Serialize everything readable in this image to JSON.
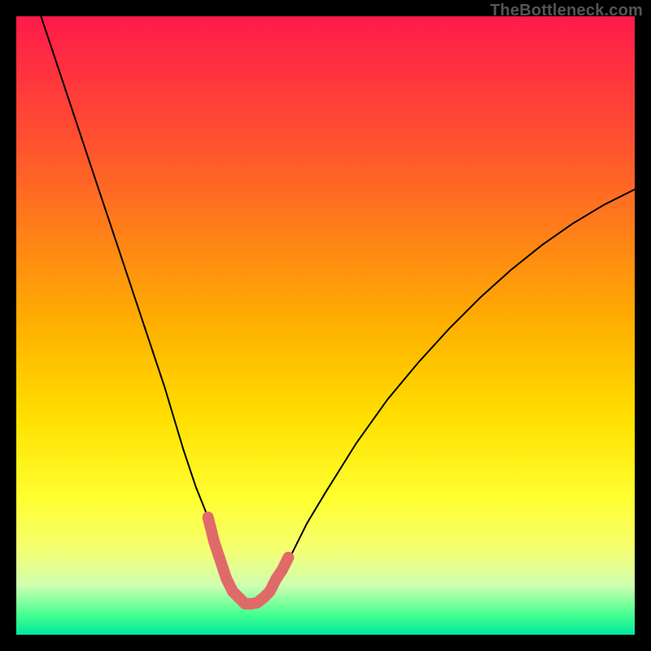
{
  "watermark": "TheBottleneck.com",
  "chart_data": {
    "type": "line",
    "title": "",
    "xlabel": "",
    "ylabel": "",
    "xlim": [
      0,
      100
    ],
    "ylim": [
      0,
      100
    ],
    "series": [
      {
        "name": "black-curve",
        "x": [
          4,
          8,
          12,
          16,
          20,
          24,
          27,
          29,
          31,
          33,
          34.5,
          36,
          37.5,
          39,
          41,
          44,
          47,
          50,
          55,
          60,
          65,
          70,
          75,
          80,
          85,
          90,
          95,
          100
        ],
        "y": [
          100,
          88,
          76,
          64,
          52,
          40,
          30,
          24,
          19,
          13,
          9,
          6,
          5,
          5,
          7,
          12,
          18,
          23,
          31,
          38,
          44,
          49.5,
          54.5,
          59,
          63,
          66.5,
          69.5,
          72
        ]
      },
      {
        "name": "pink-u-segment",
        "x": [
          31,
          32,
          33,
          34,
          35,
          36,
          37,
          38,
          39,
          40,
          41,
          42,
          43,
          44
        ],
        "y": [
          19,
          15,
          12,
          9,
          7,
          6,
          5,
          5,
          5.2,
          6,
          7,
          9,
          10.5,
          12.5
        ]
      }
    ],
    "colors": {
      "black_curve": "#000000",
      "pink_segment": "#e06a6a"
    }
  }
}
